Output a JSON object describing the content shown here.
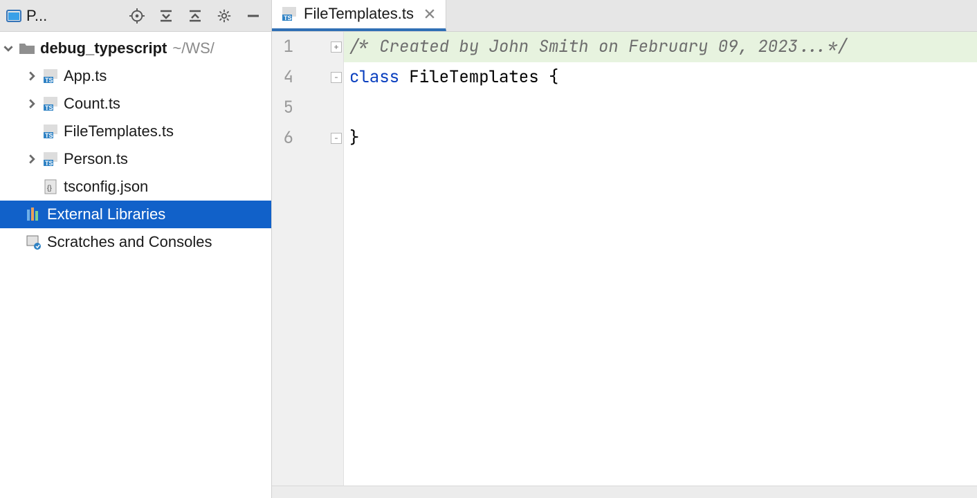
{
  "project_tool": {
    "title": "P...",
    "actions": {
      "locate": "Select Opened File",
      "expand_all": "Expand All",
      "collapse_all": "Collapse All",
      "settings": "Settings",
      "hide": "Hide"
    }
  },
  "tree": {
    "root": {
      "name": "debug_typescript",
      "path": "~/WS/",
      "expanded": true
    },
    "files": [
      {
        "name": "App.ts",
        "expandable": true
      },
      {
        "name": "Count.ts",
        "expandable": true
      },
      {
        "name": "FileTemplates.ts",
        "expandable": false
      },
      {
        "name": "Person.ts",
        "expandable": true
      },
      {
        "name": "tsconfig.json",
        "expandable": false,
        "kind": "json"
      }
    ],
    "external_libraries": "External Libraries",
    "scratches": "Scratches and Consoles",
    "selected": "External Libraries"
  },
  "tabs": [
    {
      "label": "FileTemplates.ts",
      "active": true
    }
  ],
  "editor": {
    "line_numbers": [
      "1",
      "4",
      "5",
      "6"
    ],
    "lines": {
      "l1_comment": "/* Created by John Smith on February 09, 2023...*/",
      "l4_kw": "class",
      "l4_rest": " FileTemplates {",
      "l5": "",
      "l6": "}"
    }
  }
}
